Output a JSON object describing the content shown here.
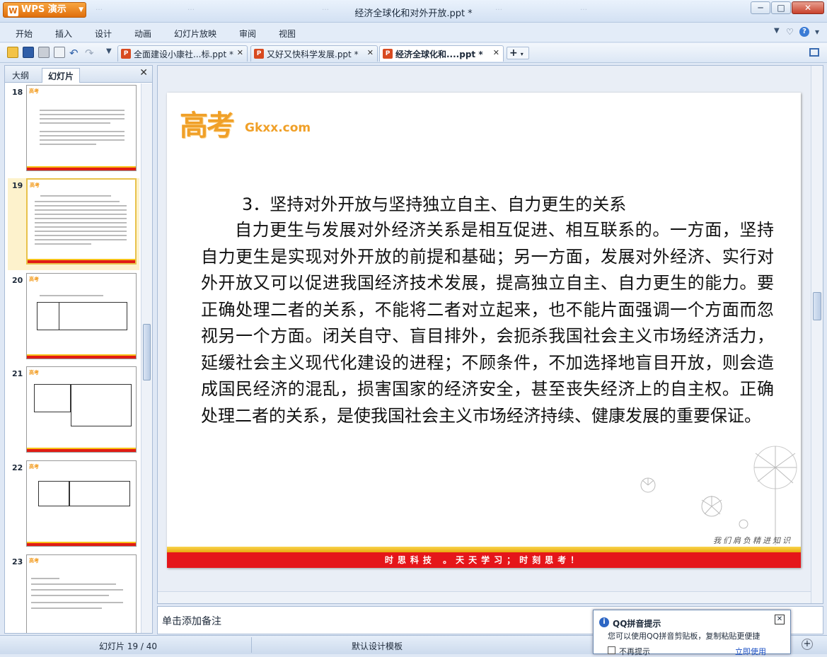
{
  "app": {
    "name": "WPS 演示",
    "logo_letter": "W"
  },
  "window": {
    "title": "经济全球化和对外开放.ppt *",
    "min": "─",
    "max": "□",
    "close": "✕"
  },
  "ghost_tabs": [
    "…",
    "…",
    "…",
    "…",
    "…"
  ],
  "menu": {
    "items": [
      "开始",
      "插入",
      "设计",
      "动画",
      "幻灯片放映",
      "审阅",
      "视图"
    ],
    "right_icons": [
      "▼",
      "♡",
      "?",
      "▾"
    ]
  },
  "toolbar": {
    "tabs": [
      {
        "label": "全面建设小康社...标.ppt *",
        "close": "✕"
      },
      {
        "label": "又好又快科学发展.ppt *",
        "close": "✕"
      },
      {
        "label": "经济全球化和....ppt *",
        "close": "✕"
      }
    ],
    "new_tab": "+"
  },
  "left_panel": {
    "tab_outline": "大纲",
    "tab_slides": "幻灯片",
    "close": "✕",
    "slides": [
      {
        "n": "18"
      },
      {
        "n": "19"
      },
      {
        "n": "20"
      },
      {
        "n": "21"
      },
      {
        "n": "22"
      },
      {
        "n": "23"
      }
    ]
  },
  "slide": {
    "logo": "高考",
    "logo_text": "Gkxx.com",
    "heading": "3．坚持对外开放与坚持独立自主、自力更生的关系",
    "body": "自力更生与发展对外经济关系是相互促进、相互联系的。一方面，坚持自力更生是实现对外开放的前提和基础；另一方面，发展对外经济、实行对外开放又可以促进我国经济技术发展，提高独立自主、自力更生的能力。要正确处理二者的关系，不能将二者对立起来，也不能片面强调一个方面而忽视另一个方面。闭关自守、盲目排外，会扼杀我国社会主义市场经济活力，延缓社会主义现代化建设的进程；不顾条件，不加选择地盲目开放，则会造成国民经济的混乱，损害国家的经济安全，甚至丧失经济上的自主权。正确处理二者的关系，是使我国社会主义市场经济持续、健康发展的重要保证。",
    "signature": "我们肩负精进知识",
    "footer": "时思科技 。天天学习；时刻思考！"
  },
  "notes": {
    "placeholder": "单击添加备注"
  },
  "status": {
    "slide_count": "幻灯片 19 / 40",
    "template": "默认设计模板"
  },
  "popup": {
    "title": "QQ拼音提示",
    "message": "您可以使用QQ拼音剪贴板，复制粘贴更便捷",
    "checkbox": "不再提示",
    "link": "立即使用",
    "close": "✕"
  }
}
